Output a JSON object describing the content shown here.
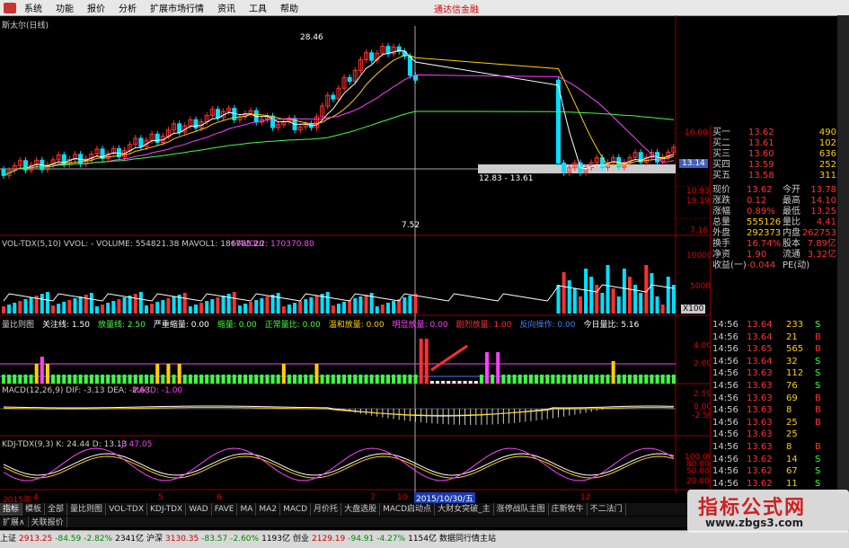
{
  "menu": {
    "items": [
      "系统",
      "功能",
      "报价",
      "分析",
      "扩展市场行情",
      "资讯",
      "工具",
      "帮助"
    ],
    "brand": "通达信金融"
  },
  "main": {
    "title": "斯太尔(日线)",
    "high_mark": "28.46",
    "low_mark": "7.52",
    "range_label": "12.83 - 13.61",
    "price_tag": "13.14",
    "axis": [
      "16.00",
      "19.19",
      "10.93",
      "7.16"
    ],
    "colors": {
      "up": "#ff3030",
      "down": "#00e0ff",
      "ma_white": "#ffffff",
      "ma_yellow": "#ffd000",
      "ma_magenta": "#ff40ff",
      "ma_green": "#40ff40"
    }
  },
  "vol": {
    "header": "VOL-TDX(5,10) VVOL: -  VOLUME: 554821.38  MAVOL1: 186785.20",
    "mavol2": "MAVOL2: 170370.80",
    "axis": [
      "10000",
      "5000",
      "X100"
    ]
  },
  "ratio": {
    "header_parts": [
      {
        "t": "量比则图",
        "c": "#cccccc"
      },
      {
        "t": "关注线: 1.50",
        "c": "#ffffff"
      },
      {
        "t": "放量线: 2.50",
        "c": "#40ff40"
      },
      {
        "t": "严重缩量: 0.00",
        "c": "#ffffff"
      },
      {
        "t": "缩量: 0.00",
        "c": "#40ff40"
      },
      {
        "t": "正常量比: 0.00",
        "c": "#40ff40"
      },
      {
        "t": "温和放量: 0.00",
        "c": "#ffd000"
      },
      {
        "t": "明显放量: 0.00",
        "c": "#ff40ff"
      },
      {
        "t": "剧烈放量: 1.00",
        "c": "#ff3030"
      },
      {
        "t": "反向操作: 0.00",
        "c": "#4080ff"
      },
      {
        "t": "今日量比: 5.16",
        "c": "#ffffff"
      }
    ],
    "axis": [
      "4.00",
      "2.00"
    ]
  },
  "macd": {
    "header": "MACD(12,26,9) DIF: -3.13  DEA: -2.63",
    "macd_val": "MACD: -1.00",
    "axis": [
      "2.59",
      "0.00",
      "-2.59"
    ]
  },
  "kdj": {
    "header": "KDJ-TDX(9,3) K: 24.44  D: 13.13",
    "j_val": "J: 47.05",
    "axis": [
      "100.00",
      "80.00",
      "50.00",
      "20.00"
    ]
  },
  "timeline": {
    "year": "2015年",
    "ticks": [
      "4",
      "5",
      "6",
      "7",
      "10",
      "12"
    ],
    "date_box": "2015/10/30/五"
  },
  "quote": {
    "levels": [
      {
        "label": "买一",
        "price": "13.62",
        "vol": "490"
      },
      {
        "label": "买二",
        "price": "13.61",
        "vol": "102"
      },
      {
        "label": "买三",
        "price": "13.60",
        "vol": "636"
      },
      {
        "label": "买四",
        "price": "13.59",
        "vol": "252"
      },
      {
        "label": "买五",
        "price": "13.58",
        "vol": "311"
      }
    ],
    "stats": [
      {
        "k1": "现价",
        "v1": "13.62",
        "k2": "今开",
        "v2": "13.78"
      },
      {
        "k1": "涨跌",
        "v1": "0.12",
        "k2": "最高",
        "v2": "14.10"
      },
      {
        "k1": "涨幅",
        "v1": "0.89%",
        "k2": "最低",
        "v2": "13.25"
      },
      {
        "k1": "总量",
        "v1": "555126",
        "k2": "量比",
        "v2": "4.41"
      },
      {
        "k1": "外盘",
        "v1": "292373",
        "k2": "内盘",
        "v2": "262753"
      },
      {
        "k1": "换手",
        "v1": "16.74%",
        "k2": "股本",
        "v2": "7.89亿"
      },
      {
        "k1": "净资",
        "v1": "1.90",
        "k2": "流通",
        "v2": "3.32亿"
      },
      {
        "k1": "收益(一)",
        "v1": "-0.044",
        "k2": "PE(动)",
        "v2": ""
      }
    ],
    "ticks": [
      {
        "t": "14:56",
        "p": "13.64",
        "v": "233",
        "d": "S"
      },
      {
        "t": "14:56",
        "p": "13.64",
        "v": "21",
        "d": "B"
      },
      {
        "t": "14:56",
        "p": "13.65",
        "v": "565",
        "d": "B"
      },
      {
        "t": "14:56",
        "p": "13.64",
        "v": "32",
        "d": "S"
      },
      {
        "t": "14:56",
        "p": "13.63",
        "v": "112",
        "d": "S"
      },
      {
        "t": "14:56",
        "p": "13.63",
        "v": "76",
        "d": "S"
      },
      {
        "t": "14:56",
        "p": "13.63",
        "v": "69",
        "d": "B"
      },
      {
        "t": "14:56",
        "p": "13.63",
        "v": "8",
        "d": "B"
      },
      {
        "t": "14:56",
        "p": "13.63",
        "v": "25",
        "d": "B"
      },
      {
        "t": "14:56",
        "p": "13.63",
        "v": "25",
        "d": ""
      },
      {
        "t": "14:56",
        "p": "13.63",
        "v": "8",
        "d": "B"
      },
      {
        "t": "14:56",
        "p": "13.62",
        "v": "14",
        "d": "S"
      },
      {
        "t": "14:56",
        "p": "13.62",
        "v": "67",
        "d": "S"
      },
      {
        "t": "14:56",
        "p": "13.62",
        "v": "11",
        "d": "S"
      }
    ]
  },
  "tabs": [
    "指标",
    "模板",
    "全部",
    "量比则图",
    "VOL-TDX",
    "KDJ-TDX",
    "WAD",
    "FAVE",
    "MA",
    "MA2",
    "MACD",
    "月价托",
    "大盘选股",
    "MACD启动点",
    "大财女突破_主",
    "涨停战队主图",
    "庄新牧牛",
    "不二法门"
  ],
  "subtabs": [
    "扩展∧",
    "关联报价"
  ],
  "status": [
    {
      "t": "上证",
      "c": "#000"
    },
    {
      "t": "2913.25",
      "c": "#c00"
    },
    {
      "t": "-84.59",
      "c": "#080"
    },
    {
      "t": "-2.82%",
      "c": "#080"
    },
    {
      "t": "2341亿",
      "c": "#000"
    },
    {
      "t": "沪深",
      "c": "#000"
    },
    {
      "t": "3130.35",
      "c": "#c00"
    },
    {
      "t": "-83.57",
      "c": "#080"
    },
    {
      "t": "-2.60%",
      "c": "#080"
    },
    {
      "t": "1193亿",
      "c": "#000"
    },
    {
      "t": "创业",
      "c": "#000"
    },
    {
      "t": "2129.19",
      "c": "#c00"
    },
    {
      "t": "-94.91",
      "c": "#080"
    },
    {
      "t": "-4.27%",
      "c": "#080"
    },
    {
      "t": "1154亿",
      "c": "#000"
    },
    {
      "t": "数据同行情主站",
      "c": "#000"
    }
  ],
  "watermark": {
    "line1": "指标公式网",
    "line2": "www.zbgs3.com"
  }
}
